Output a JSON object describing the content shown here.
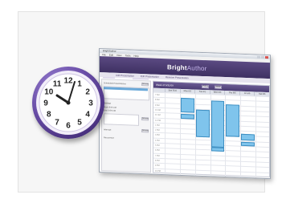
{
  "app": {
    "window_title": "BrightAuthor",
    "brand_main": "Bright",
    "brand_sub": "Author",
    "menu": [
      "File",
      "Edit",
      "View",
      "Tools",
      "Help"
    ],
    "tabs": [
      "File",
      "Setup",
      "Publish",
      "Schedule"
    ],
    "sub_nav": [
      "Add Presentation",
      "Edit Presentation",
      "Remove Presentation"
    ]
  },
  "left_pane": {
    "label_1": "Scheduled Presentations",
    "button_1": "Browse",
    "label_2": "Settings",
    "field_1": "Start: 8:00 AM",
    "field_2": "End: 9:00 AM",
    "button_2": "Browse",
    "label_3": "Interrupt",
    "button_3": "Browse",
    "label_4": "Recurrence"
  },
  "calendar": {
    "title": "Week of 5/31/09",
    "buttons": [
      "Today",
      "Week"
    ],
    "days": [
      "Sun 5/31",
      "Mon 6/1",
      "Tue 6/2",
      "Wed 6/3",
      "Thu 6/4",
      "Fri 6/5",
      "Sat 6/6"
    ],
    "hours": [
      "7 AM",
      "8 AM",
      "9 AM",
      "10 AM",
      "11 AM",
      "12 PM",
      "1 PM",
      "2 PM",
      "3 PM",
      "4 PM",
      "5 PM",
      "6 PM",
      "7 PM",
      "8 PM",
      "9 PM",
      "10 PM"
    ],
    "event_color": "#7fc4ec"
  },
  "clock": {
    "numbers": [
      "12",
      "1",
      "2",
      "3",
      "4",
      "5",
      "6",
      "7",
      "8",
      "9",
      "10",
      "11"
    ],
    "time": "10:09",
    "rim_color": "#6a4ea8",
    "face_color": "#ffffff"
  }
}
